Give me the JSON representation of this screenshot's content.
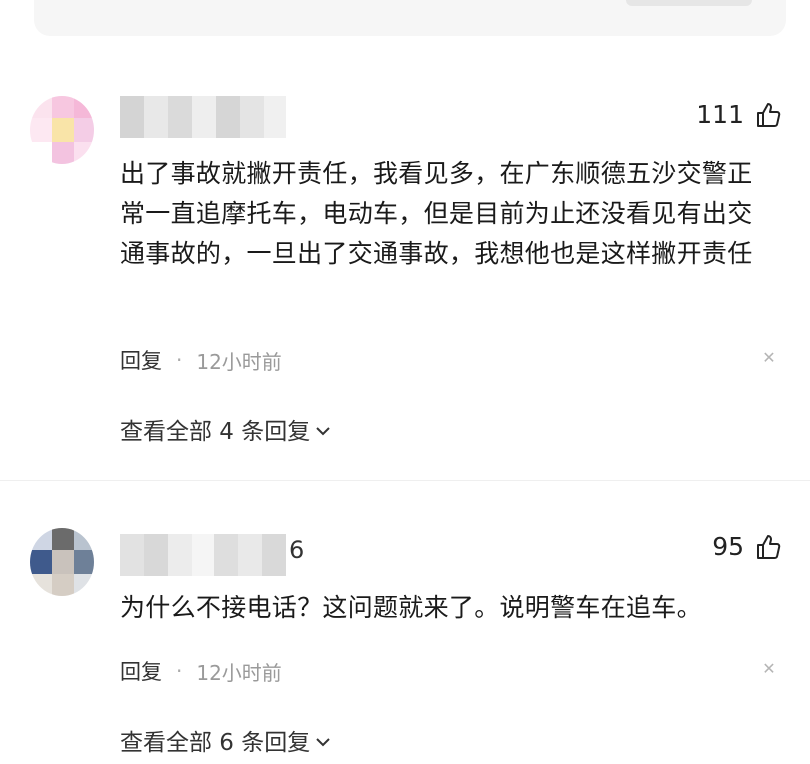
{
  "comments": [
    {
      "suffix": "",
      "likes": "111",
      "text": "出了事故就撇开责任，我看见多，在广东顺德五沙交警正常一直追摩托车，电动车，但是目前为止还没看见有出交通事故的，一旦出了交通事故，我想他也是这样撇开责任",
      "reply_label": "回复",
      "separator": "·",
      "time": "12小时前",
      "view_replies": "查看全部 4 条回复"
    },
    {
      "suffix": "6",
      "likes": "95",
      "text": "为什么不接电话？这问题就来了。说明警车在追车。",
      "reply_label": "回复",
      "separator": "·",
      "time": "12小时前",
      "view_replies": "查看全部 6 条回复"
    }
  ],
  "colors": {
    "text": "#1a1a1a",
    "muted": "#9a9a9a",
    "accent": "#222222"
  },
  "icons": [
    "thumbs-up-icon",
    "close-icon",
    "chevron-down-icon"
  ]
}
